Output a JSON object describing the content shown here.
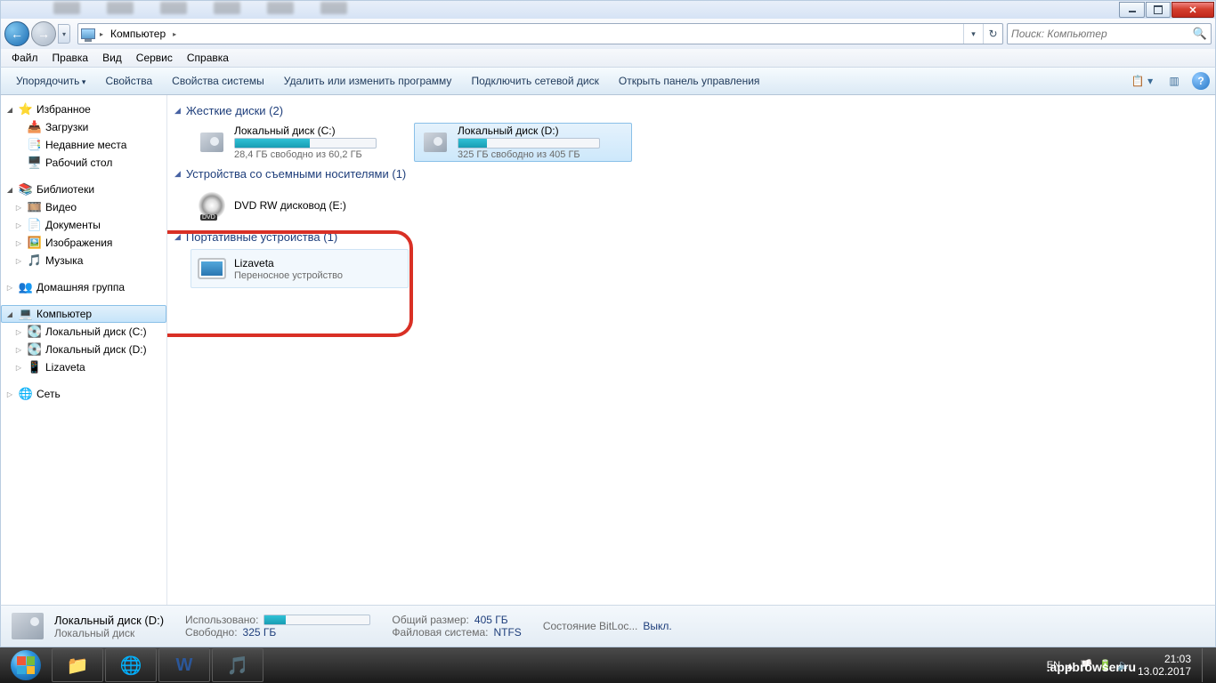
{
  "window_controls": {
    "minimize": "_",
    "maximize": "□",
    "close": "✕"
  },
  "nav": {
    "breadcrumb": "Компьютер",
    "search_placeholder": "Поиск: Компьютер"
  },
  "menu": {
    "file": "Файл",
    "edit": "Правка",
    "view": "Вид",
    "tools": "Сервис",
    "help": "Справка"
  },
  "toolbar": {
    "organize": "Упорядочить",
    "properties": "Свойства",
    "system_properties": "Свойства системы",
    "uninstall": "Удалить или изменить программу",
    "map_drive": "Подключить сетевой диск",
    "control_panel": "Открыть панель управления"
  },
  "sidebar": {
    "favorites": "Избранное",
    "downloads": "Загрузки",
    "recent": "Недавние места",
    "desktop": "Рабочий стол",
    "libraries": "Библиотеки",
    "videos": "Видео",
    "documents": "Документы",
    "pictures": "Изображения",
    "music": "Музыка",
    "homegroup": "Домашняя группа",
    "computer": "Компьютер",
    "local_c": "Локальный диск (C:)",
    "local_d": "Локальный диск (D:)",
    "lizaveta": "Lizaveta",
    "network": "Сеть"
  },
  "content": {
    "hdd_header": "Жесткие диски (2)",
    "drive_c": {
      "name": "Локальный диск (C:)",
      "sub": "28,4 ГБ свободно из 60,2 ГБ",
      "fill": 53
    },
    "drive_d": {
      "name": "Локальный диск (D:)",
      "sub": "325 ГБ свободно из 405 ГБ",
      "fill": 20
    },
    "removable_header": "Устройства со съемными носителями (1)",
    "dvd": {
      "name": "DVD RW дисковод (E:)"
    },
    "portable_header": "Портативные устройства (1)",
    "portable": {
      "name": "Lizaveta",
      "sub": "Переносное устройство"
    }
  },
  "details": {
    "title": "Локальный диск (D:)",
    "type": "Локальный диск",
    "used_label": "Использовано:",
    "free_label": "Свободно:",
    "free_value": "325 ГБ",
    "total_label": "Общий размер:",
    "total_value": "405 ГБ",
    "fs_label": "Файловая система:",
    "fs_value": "NTFS",
    "bitlocker_label": "Состояние BitLoc...",
    "bitlocker_value": "Выкл."
  },
  "tray": {
    "lang": "EN",
    "time": "21:03",
    "date": "13.02.2017"
  },
  "watermark": ".appbrowser.ru"
}
